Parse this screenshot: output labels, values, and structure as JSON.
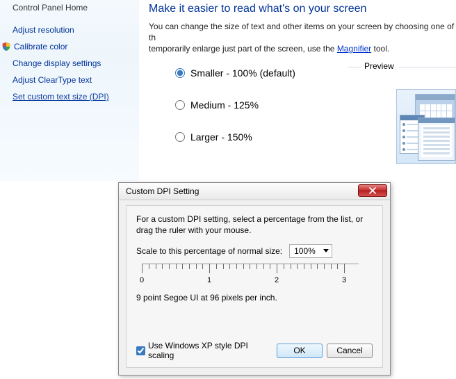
{
  "left_panel": {
    "top_cut": "Control Panel Home",
    "links": {
      "adjust_resolution": "Adjust resolution",
      "calibrate_color": "Calibrate color",
      "change_display_settings": "Change display settings",
      "adjust_cleartype": "Adjust ClearType text",
      "set_custom_dpi": "Set custom text size (DPI)"
    }
  },
  "main": {
    "title": "Make it easier to read what's on your screen",
    "desc_prefix": "You can change the size of text and other items on your screen by choosing one of th",
    "desc_line2_prefix": "temporarily enlarge just part of the screen, use the ",
    "desc_link": "Magnifier",
    "desc_line2_suffix": " tool.",
    "options": {
      "smaller": "Smaller - 100% (default)",
      "medium": "Medium - 125%",
      "larger": "Larger - 150%"
    },
    "preview_label": "Preview"
  },
  "dialog": {
    "title": "Custom DPI Setting",
    "intro": "For a custom DPI setting, select a percentage from the list, or drag the ruler with your mouse.",
    "scale_label": "Scale to this percentage of normal size:",
    "scale_value": "100%",
    "ruler_numbers": [
      "0",
      "1",
      "2",
      "3"
    ],
    "readout": "9 point Segoe UI at 96 pixels per inch.",
    "xp_checkbox": "Use Windows XP style DPI scaling",
    "ok": "OK",
    "cancel": "Cancel"
  }
}
